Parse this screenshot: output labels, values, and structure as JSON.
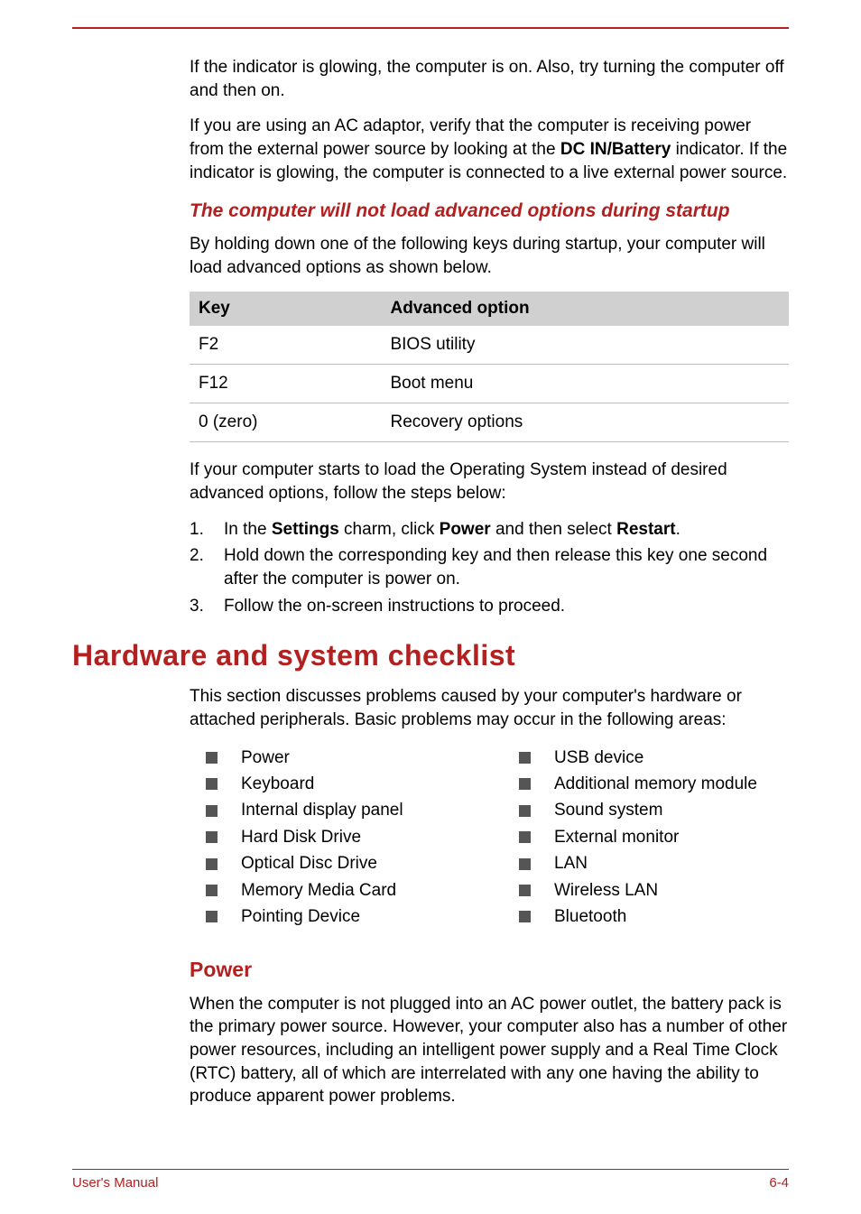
{
  "intro": {
    "p1_a": "If the indicator is glowing, the computer is on. Also, try turning the computer off and then on.",
    "p2_a": "If you are using an AC adaptor, verify that the computer is receiving power from the external power source by looking at the ",
    "p2_bold": "DC IN/Battery",
    "p2_b": " indicator. If the indicator is glowing, the computer is connected to a live external power source."
  },
  "subhead1": "The computer will not load advanced options during startup",
  "p3": "By holding down one of the following keys during startup, your computer will load advanced options as shown below.",
  "table": {
    "head_key": "Key",
    "head_opt": "Advanced option",
    "rows": [
      {
        "key": "F2",
        "opt": "BIOS utility"
      },
      {
        "key": "F12",
        "opt": "Boot menu"
      },
      {
        "key": "0 (zero)",
        "opt": "Recovery options"
      }
    ]
  },
  "p4": "If your computer starts to load the Operating System instead of desired advanced options, follow the steps below:",
  "steps": {
    "s1_a": "In the ",
    "s1_b1": "Settings",
    "s1_c": " charm, click ",
    "s1_b2": "Power",
    "s1_d": " and then select ",
    "s1_b3": "Restart",
    "s1_e": ".",
    "s2": "Hold down the corresponding key and then release this key one second after the computer is power on.",
    "s3": "Follow the on-screen instructions to proceed."
  },
  "h1": "Hardware and system checklist",
  "p5": "This section discusses problems caused by your computer's hardware or attached peripherals. Basic problems may occur in the following areas:",
  "list_left": [
    "Power",
    "Keyboard",
    "Internal display panel",
    "Hard Disk Drive",
    "Optical Disc Drive",
    "Memory Media Card",
    "Pointing Device"
  ],
  "list_right": [
    "USB device",
    "Additional memory module",
    "Sound system",
    "External monitor",
    "LAN",
    "Wireless LAN",
    "Bluetooth"
  ],
  "h2": "Power",
  "p6": "When the computer is not plugged into an AC power outlet, the battery pack is the primary power source. However, your computer also has a number of other power resources, including an intelligent power supply and a Real Time Clock (RTC) battery, all of which are interrelated with any one having the ability to produce apparent power problems.",
  "footer": {
    "left": "User's Manual",
    "right": "6-4"
  }
}
